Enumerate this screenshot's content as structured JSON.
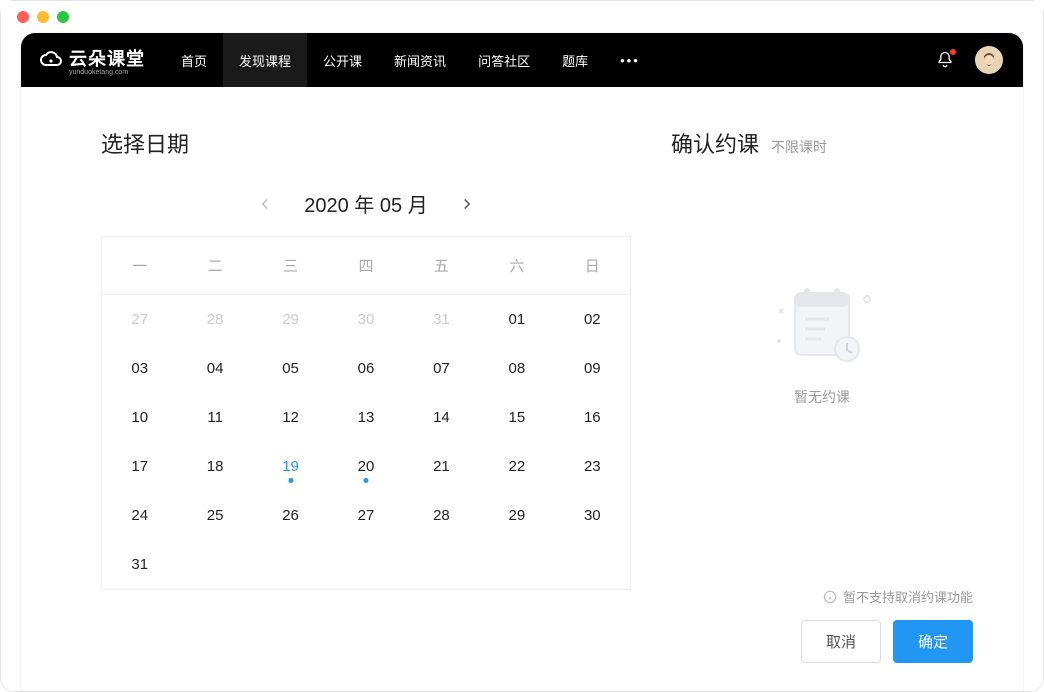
{
  "logo": {
    "text": "云朵课堂",
    "sub": "yunduoketang.com"
  },
  "nav": {
    "items": [
      "首页",
      "发现课程",
      "公开课",
      "新闻资讯",
      "问答社区",
      "题库"
    ],
    "activeIndex": 1
  },
  "calendar": {
    "title": "选择日期",
    "monthLabel": "2020 年 05 月",
    "weekdays": [
      "一",
      "二",
      "三",
      "四",
      "五",
      "六",
      "日"
    ],
    "days": [
      {
        "n": "27",
        "dim": true
      },
      {
        "n": "28",
        "dim": true
      },
      {
        "n": "29",
        "dim": true
      },
      {
        "n": "30",
        "dim": true
      },
      {
        "n": "31",
        "dim": true
      },
      {
        "n": "01"
      },
      {
        "n": "02"
      },
      {
        "n": "03"
      },
      {
        "n": "04"
      },
      {
        "n": "05"
      },
      {
        "n": "06"
      },
      {
        "n": "07"
      },
      {
        "n": "08"
      },
      {
        "n": "09"
      },
      {
        "n": "10"
      },
      {
        "n": "11"
      },
      {
        "n": "12"
      },
      {
        "n": "13"
      },
      {
        "n": "14"
      },
      {
        "n": "15"
      },
      {
        "n": "16"
      },
      {
        "n": "17"
      },
      {
        "n": "18"
      },
      {
        "n": "19",
        "today": true,
        "dot": true
      },
      {
        "n": "20",
        "dot": true
      },
      {
        "n": "21"
      },
      {
        "n": "22"
      },
      {
        "n": "23"
      },
      {
        "n": "24"
      },
      {
        "n": "25"
      },
      {
        "n": "26"
      },
      {
        "n": "27"
      },
      {
        "n": "28"
      },
      {
        "n": "29"
      },
      {
        "n": "30"
      },
      {
        "n": "31"
      }
    ]
  },
  "confirm": {
    "title": "确认约课",
    "subtitle": "不限课时",
    "emptyText": "暂无约课",
    "note": "暂不支持取消约课功能",
    "cancelLabel": "取消",
    "okLabel": "确定"
  }
}
